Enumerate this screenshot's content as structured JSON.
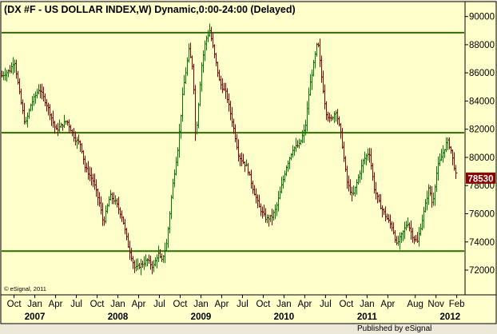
{
  "chart_data": {
    "type": "ohlc",
    "title": "(DX #F - US DOLLAR INDEX,W) Dynamic,0:00-24:00 (Delayed)",
    "copyright": "© eSignal, 2011",
    "footer": "Published by eSignal",
    "y_axis": {
      "side": "right",
      "ticks": [
        72000,
        74000,
        76000,
        78000,
        80000,
        82000,
        84000,
        86000,
        88000,
        90000
      ],
      "labels": [
        "72000",
        "74000",
        "76000",
        "78000",
        "80000",
        "82000",
        "84000",
        "86000",
        "88000",
        "90000"
      ],
      "range": [
        70300,
        91000
      ]
    },
    "last_price": {
      "value": 78530,
      "label": "78530",
      "color": "#8b0000"
    },
    "x_axis": {
      "months": [
        {
          "label": "Oct",
          "t": 2006.75
        },
        {
          "label": "Jan",
          "t": 2007.0
        },
        {
          "label": "Apr",
          "t": 2007.25
        },
        {
          "label": "Jul",
          "t": 2007.5
        },
        {
          "label": "Oct",
          "t": 2007.75
        },
        {
          "label": "Jan",
          "t": 2008.0
        },
        {
          "label": "Apr",
          "t": 2008.25
        },
        {
          "label": "Jul",
          "t": 2008.5
        },
        {
          "label": "Oct",
          "t": 2008.75
        },
        {
          "label": "Jan",
          "t": 2009.0
        },
        {
          "label": "Apr",
          "t": 2009.25
        },
        {
          "label": "Jul",
          "t": 2009.5
        },
        {
          "label": "Oct",
          "t": 2009.75
        },
        {
          "label": "Jan",
          "t": 2010.0
        },
        {
          "label": "Apr",
          "t": 2010.25
        },
        {
          "label": "Jul",
          "t": 2010.5
        },
        {
          "label": "Oct",
          "t": 2010.75
        },
        {
          "label": "Jan",
          "t": 2011.0
        },
        {
          "label": "Apr",
          "t": 2011.25
        },
        {
          "label": "Aug",
          "t": 2011.58
        },
        {
          "label": "Nov",
          "t": 2011.83
        },
        {
          "label": "Feb",
          "t": 2012.08
        }
      ],
      "years": [
        {
          "label": "2007",
          "t": 2007.0
        },
        {
          "label": "2008",
          "t": 2008.0
        },
        {
          "label": "2009",
          "t": 2009.0
        },
        {
          "label": "2010",
          "t": 2010.0
        },
        {
          "label": "2011",
          "t": 2011.0
        },
        {
          "label": "2012",
          "t": 2012.0
        }
      ],
      "range": [
        2006.6,
        2012.17
      ]
    },
    "horizontal_lines": [
      {
        "value": 88850,
        "color": "#2e6b00"
      },
      {
        "value": 81750,
        "color": "#2e6b00"
      },
      {
        "value": 73350,
        "color": "#2e6b00"
      }
    ],
    "anchors": [
      [
        2006.6,
        85800
      ],
      [
        2006.7,
        86200
      ],
      [
        2006.75,
        86900
      ],
      [
        2006.82,
        84200
      ],
      [
        2006.88,
        82300
      ],
      [
        2006.95,
        83800
      ],
      [
        2007.05,
        84900
      ],
      [
        2007.15,
        83600
      ],
      [
        2007.25,
        81900
      ],
      [
        2007.38,
        82600
      ],
      [
        2007.48,
        81300
      ],
      [
        2007.55,
        80900
      ],
      [
        2007.6,
        79300
      ],
      [
        2007.7,
        78300
      ],
      [
        2007.78,
        76600
      ],
      [
        2007.82,
        75300
      ],
      [
        2007.9,
        77300
      ],
      [
        2007.97,
        76800
      ],
      [
        2008.05,
        75700
      ],
      [
        2008.12,
        73700
      ],
      [
        2008.2,
        72100
      ],
      [
        2008.28,
        72400
      ],
      [
        2008.35,
        72700
      ],
      [
        2008.42,
        72200
      ],
      [
        2008.48,
        73200
      ],
      [
        2008.52,
        72600
      ],
      [
        2008.58,
        73800
      ],
      [
        2008.65,
        77800
      ],
      [
        2008.72,
        80800
      ],
      [
        2008.78,
        84800
      ],
      [
        2008.85,
        87600
      ],
      [
        2008.9,
        86200
      ],
      [
        2008.93,
        81200
      ],
      [
        2009.0,
        86400
      ],
      [
        2009.05,
        88300
      ],
      [
        2009.1,
        89000
      ],
      [
        2009.16,
        87200
      ],
      [
        2009.22,
        85300
      ],
      [
        2009.3,
        84500
      ],
      [
        2009.38,
        82300
      ],
      [
        2009.45,
        80100
      ],
      [
        2009.55,
        79300
      ],
      [
        2009.62,
        77800
      ],
      [
        2009.7,
        76400
      ],
      [
        2009.78,
        75600
      ],
      [
        2009.85,
        75800
      ],
      [
        2009.9,
        76400
      ],
      [
        2009.95,
        77600
      ],
      [
        2010.02,
        79300
      ],
      [
        2010.1,
        80600
      ],
      [
        2010.18,
        80900
      ],
      [
        2010.25,
        82100
      ],
      [
        2010.3,
        84900
      ],
      [
        2010.35,
        86600
      ],
      [
        2010.4,
        88300
      ],
      [
        2010.45,
        85500
      ],
      [
        2010.5,
        83200
      ],
      [
        2010.55,
        82600
      ],
      [
        2010.62,
        83300
      ],
      [
        2010.68,
        81600
      ],
      [
        2010.75,
        78300
      ],
      [
        2010.82,
        77200
      ],
      [
        2010.9,
        78800
      ],
      [
        2010.95,
        79800
      ],
      [
        2011.02,
        80400
      ],
      [
        2011.08,
        77800
      ],
      [
        2011.15,
        76600
      ],
      [
        2011.22,
        75800
      ],
      [
        2011.3,
        75000
      ],
      [
        2011.35,
        73800
      ],
      [
        2011.42,
        74600
      ],
      [
        2011.48,
        75400
      ],
      [
        2011.55,
        74300
      ],
      [
        2011.6,
        74000
      ],
      [
        2011.68,
        76200
      ],
      [
        2011.74,
        77900
      ],
      [
        2011.78,
        76600
      ],
      [
        2011.84,
        79300
      ],
      [
        2011.9,
        80200
      ],
      [
        2011.96,
        81200
      ],
      [
        2012.0,
        80600
      ],
      [
        2012.04,
        79400
      ],
      [
        2012.07,
        78530
      ]
    ]
  }
}
